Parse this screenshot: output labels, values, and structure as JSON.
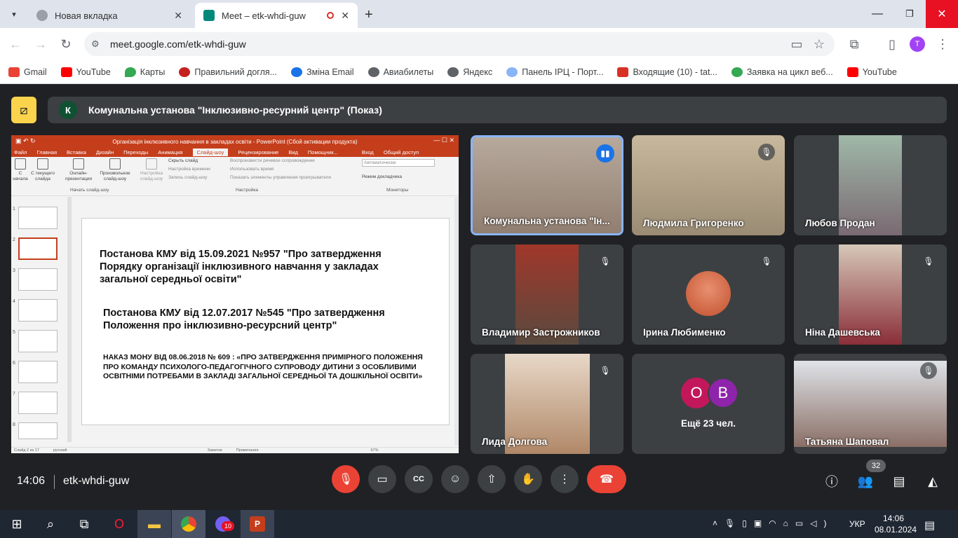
{
  "browser": {
    "tabs": [
      {
        "title": "Новая вкладка"
      },
      {
        "title": "Meet – etk-whdi-guw"
      }
    ],
    "url": "meet.google.com/etk-whdi-guw",
    "profile_initial": "T",
    "bookmarks": [
      {
        "label": "Gmail",
        "color": "#ea4335"
      },
      {
        "label": "YouTube",
        "color": "#ff0000"
      },
      {
        "label": "Карты",
        "color": "#34a853"
      },
      {
        "label": "Правильний догля...",
        "color": "#c5221f"
      },
      {
        "label": "Зміна Email",
        "color": "#1a73e8"
      },
      {
        "label": "Авиабилеты",
        "color": "#5f6368"
      },
      {
        "label": "Яндекс",
        "color": "#5f6368"
      },
      {
        "label": "Панель ІРЦ - Порт...",
        "color": "#8ab4f8"
      },
      {
        "label": "Входящие (10) - tat...",
        "color": "#d93025"
      },
      {
        "label": "Заявка на цикл веб...",
        "color": "#34a853"
      },
      {
        "label": "YouTube",
        "color": "#ff0000"
      }
    ]
  },
  "meet": {
    "presenter_initial": "К",
    "presenter_title": "Комунальна установа \"Інклюзивно-ресурний центр\" (Показ)",
    "time": "14:06",
    "meeting_code": "etk-whdi-guw",
    "participants_count": "32",
    "participants": [
      {
        "name": "Комунальна установа \"Ін...",
        "speaking": true
      },
      {
        "name": "Людмила Григоренко"
      },
      {
        "name": "Любов Продан"
      },
      {
        "name": "Владимир Застрожников"
      },
      {
        "name": "Ірина Любименко"
      },
      {
        "name": "Ніна Дашевська"
      },
      {
        "name": "Лида Долгова"
      },
      {
        "name": "Ещё 23 чел.",
        "avatars": [
          "О",
          "В"
        ]
      },
      {
        "name": "Татьяна Шаповал"
      }
    ]
  },
  "ppt": {
    "title": "Організація інклюзивного навчання в закладах освіти - PowerPoint (Сбой активации продукта)",
    "tabs": [
      "Файл",
      "Главная",
      "Вставка",
      "Дизайн",
      "Переходы",
      "Анимация",
      "Слайд-шоу",
      "Рецензирование",
      "Вид",
      "Помощник...",
      "Вход",
      "Общий доступ"
    ],
    "ribbon": {
      "from_start": "С начала",
      "from_current": "С текущего слайда",
      "online": "Онлайн-презентация",
      "custom": "Произвольное слайд-шоу",
      "setup": "Настройка слайд-шоу",
      "hide": "Скрыть слайд",
      "timing": "Настройка времени",
      "record": "Запись слайд-шоу",
      "narration": "Воспроизвести речевое сопровождение",
      "use_timing": "Использовать время",
      "show_controls": "Показать элементы управления проигрывателя",
      "monitor": "Автоматически",
      "presenter_view": "Режим докладчика",
      "group_start": "Начать слайд-шоу",
      "group_setup": "Настройка",
      "group_monitors": "Мониторы"
    },
    "slide_numbers": [
      "1",
      "2",
      "3",
      "4",
      "5",
      "6",
      "7",
      "8"
    ],
    "slide": {
      "p1": "Постанова КМУ від 15.09.2021 №957 \"Про затвердження Порядку організації інклюзивного навчання у закладах загальної середньої освіти\"",
      "p2": "Постанова КМУ від 12.07.2017 №545 \"Про затвердження Положення про інклюзивно-ресурсний центр\"",
      "p3": "НАКАЗ МОНУ ВІД 08.06.2018 № 609 : «ПРО ЗАТВЕРДЖЕННЯ ПРИМІРНОГО ПОЛОЖЕННЯ ПРО КОМАНДУ ПСИХОЛОГО-ПЕДАГОГІЧНОГО СУПРОВОДУ ДИТИНИ З ОСОБЛИВИМИ ОСВІТНІМИ ПОТРЕБАМИ В ЗАКЛАДІ ЗАГАЛЬНОЇ СЕРЕДНЬОЇ ТА ДОШКІЛЬНОЇ ОСВІТИ»"
    },
    "status": {
      "slide": "Слайд 2 из 17",
      "lang": "русский",
      "notes": "Заметки",
      "comments": "Примечания",
      "zoom": "67%"
    }
  },
  "taskbar": {
    "lang": "УКР",
    "time": "14:06",
    "date": "08.01.2024",
    "viber_badge": "10"
  }
}
